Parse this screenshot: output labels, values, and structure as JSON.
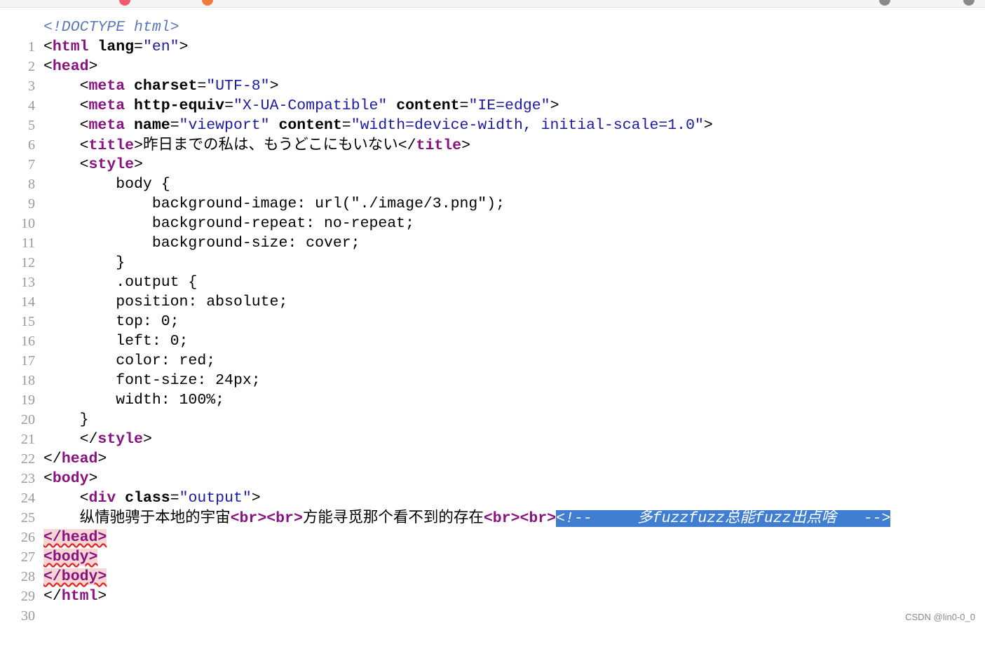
{
  "source_view": {
    "line_numbers": [
      "1",
      "2",
      "3",
      "4",
      "5",
      "6",
      "7",
      "8",
      "9",
      "10",
      "11",
      "12",
      "13",
      "14",
      "15",
      "16",
      "17",
      "18",
      "19",
      "20",
      "21",
      "22",
      "23",
      "24",
      "25",
      "26",
      "27",
      "28",
      "29",
      "30"
    ],
    "lines": {
      "l1_doctype": "<!DOCTYPE html>",
      "l2_open": "<",
      "l2_tag": "html",
      "l2_attr": " lang",
      "l2_eq": "=",
      "l2_val": "\"en\"",
      "l2_close": ">",
      "l3_open": "<",
      "l3_tag": "head",
      "l3_close": ">",
      "l4_indent": "    ",
      "l4_open": "<",
      "l4_tag": "meta",
      "l4_attr": " charset",
      "l4_eq": "=",
      "l4_val": "\"UTF-8\"",
      "l4_close": ">",
      "l5_indent": "    ",
      "l5_open": "<",
      "l5_tag": "meta",
      "l5_attr1": " http-equiv",
      "l5_eq1": "=",
      "l5_val1": "\"X-UA-Compatible\"",
      "l5_attr2": " content",
      "l5_eq2": "=",
      "l5_val2": "\"IE=edge\"",
      "l5_close": ">",
      "l6_indent": "    ",
      "l6_open": "<",
      "l6_tag": "meta",
      "l6_attr1": " name",
      "l6_eq1": "=",
      "l6_val1": "\"viewport\"",
      "l6_attr2": " content",
      "l6_eq2": "=",
      "l6_val2": "\"width=device-width, initial-scale=1.0\"",
      "l6_close": ">",
      "l7_indent": "    ",
      "l7_open": "<",
      "l7_tag": "title",
      "l7_close": ">",
      "l7_text": "昨日までの私は、もうどこにもいない",
      "l7_end_open": "</",
      "l7_end_tag": "title",
      "l7_end_close": ">",
      "l8_indent": "    ",
      "l8_open": "<",
      "l8_tag": "style",
      "l8_close": ">",
      "l9": "        body {",
      "l10": "            background-image: url(\"./image/3.png\");",
      "l11": "            background-repeat: no-repeat;",
      "l12": "            background-size: cover;",
      "l13": "        }",
      "l14": "        .output {",
      "l15": "        position: absolute;",
      "l16": "        top: 0;",
      "l17": "        left: 0;",
      "l18": "        color: red;",
      "l19": "        font-size: 24px;",
      "l20": "        width: 100%;",
      "l21": "    }",
      "l22_indent": "    ",
      "l22_open": "</",
      "l22_tag": "style",
      "l22_close": ">",
      "l23_open": "</",
      "l23_tag": "head",
      "l23_close": ">",
      "l24_open": "<",
      "l24_tag": "body",
      "l24_close": ">",
      "l25_indent": "    ",
      "l25_open": "<",
      "l25_tag": "div",
      "l25_attr": " class",
      "l25_eq": "=",
      "l25_val": "\"output\"",
      "l25_close": ">",
      "l26_indent": "    ",
      "l26_text1": "纵情驰骋于本地的宇宙",
      "l26_br1": "<br>",
      "l26_br2": "<br>",
      "l26_text2": "方能寻觅那个看不到的存在",
      "l26_br3": "<br>",
      "l26_br4": "<br>",
      "l26_comment": "<!--     多fuzzfuzz总能fuzz出点啥   -->",
      "l27": "</head>",
      "l28": "<body>",
      "l29": "</body>",
      "l30_open": "</",
      "l30_tag": "html",
      "l30_close": ">"
    }
  },
  "footer": {
    "watermark": "CSDN @lin0-0_0"
  },
  "colors": {
    "tag": "#881280",
    "attr_value": "#1a1aa6",
    "doctype": "#5c7ab8",
    "selection": "#3f7ed1",
    "error_bg": "#f8d5d5",
    "line_number": "#9a9a9a"
  }
}
